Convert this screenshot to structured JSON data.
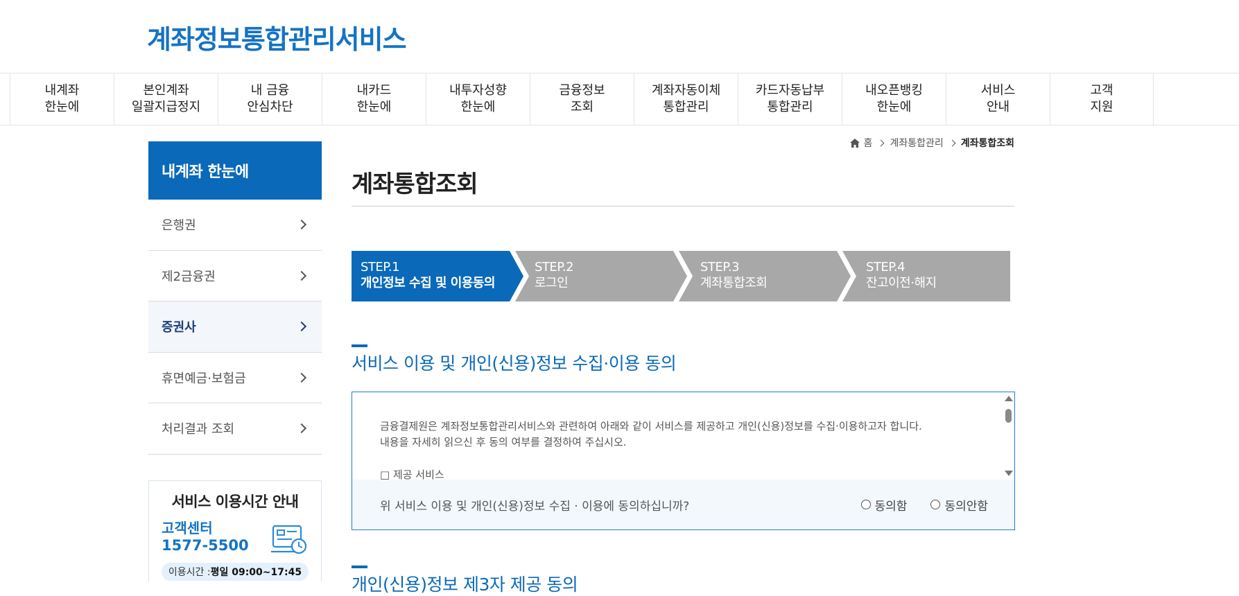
{
  "header": {
    "logo": "계좌정보통합관리서비스"
  },
  "gnb": [
    "내계좌\n한눈에",
    "본인계좌\n일괄지급정지",
    "내 금융\n안심차단",
    "내카드\n한눈에",
    "내투자성향\n한눈에",
    "금융정보\n조회",
    "계좌자동이체\n통합관리",
    "카드자동납부\n통합관리",
    "내오픈뱅킹\n한눈에",
    "서비스\n안내",
    "고객\n지원"
  ],
  "sidebar": {
    "title": "내계좌 한눈에",
    "items": [
      {
        "label": "은행권"
      },
      {
        "label": "제2금융권"
      },
      {
        "label": "증권사"
      },
      {
        "label": "휴면예금·보험금"
      },
      {
        "label": "처리결과 조회"
      }
    ],
    "info": {
      "title": "서비스 이용시간 안내",
      "center": "고객센터",
      "phone": "1577-5500",
      "time_label": "이용시간 : ",
      "time_value": "평일 09:00~17:45"
    }
  },
  "breadcrumb": {
    "home": "홈",
    "level1": "계좌통합관리",
    "current": "계좌통합조회"
  },
  "page": {
    "title": "계좌통합조회"
  },
  "steps": [
    {
      "label": "STEP.1",
      "name": "개인정보 수집 및 이용동의"
    },
    {
      "label": "STEP.2",
      "name": "로그인"
    },
    {
      "label": "STEP.3",
      "name": "계좌통합조회"
    },
    {
      "label": "STEP.4",
      "name": "잔고이전·해지"
    }
  ],
  "section1": {
    "title": "서비스 이용 및 개인(신용)정보 수집·이용 동의",
    "text1": "금융결제원은 계좌정보통합관리서비스와 관련하여 아래와 같이 서비스를 제공하고 개인(신용)정보를 수집·이용하고자 합니다.",
    "text2": "내용을 자세히 읽으신 후 동의 여부를 결정하여 주십시오.",
    "text3": "□ 제공 서비스",
    "question": "위 서비스 이용 및 개인(신용)정보 수집 · 이용에 동의하십니까?",
    "agree": "동의함",
    "disagree": "동의안함"
  },
  "section2": {
    "title": "개인(신용)정보 제3자 제공 동의"
  },
  "colors": {
    "brand": "#0a69b9",
    "step_active": "#0a69b9",
    "step_inactive": "#a8a8a8"
  }
}
